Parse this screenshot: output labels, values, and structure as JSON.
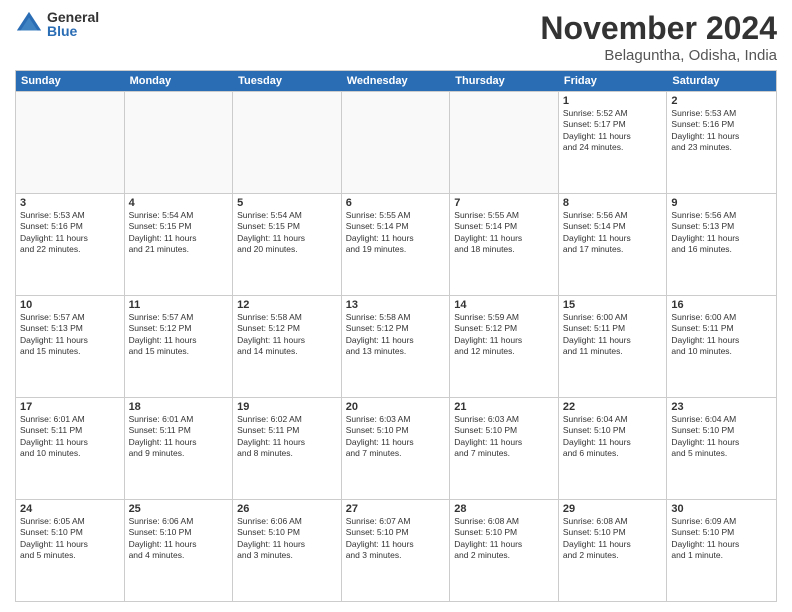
{
  "logo": {
    "general": "General",
    "blue": "Blue"
  },
  "title": "November 2024",
  "location": "Belaguntha, Odisha, India",
  "days_of_week": [
    "Sunday",
    "Monday",
    "Tuesday",
    "Wednesday",
    "Thursday",
    "Friday",
    "Saturday"
  ],
  "weeks": [
    [
      {
        "day": "",
        "info": ""
      },
      {
        "day": "",
        "info": ""
      },
      {
        "day": "",
        "info": ""
      },
      {
        "day": "",
        "info": ""
      },
      {
        "day": "",
        "info": ""
      },
      {
        "day": "1",
        "info": "Sunrise: 5:52 AM\nSunset: 5:17 PM\nDaylight: 11 hours\nand 24 minutes."
      },
      {
        "day": "2",
        "info": "Sunrise: 5:53 AM\nSunset: 5:16 PM\nDaylight: 11 hours\nand 23 minutes."
      }
    ],
    [
      {
        "day": "3",
        "info": "Sunrise: 5:53 AM\nSunset: 5:16 PM\nDaylight: 11 hours\nand 22 minutes."
      },
      {
        "day": "4",
        "info": "Sunrise: 5:54 AM\nSunset: 5:15 PM\nDaylight: 11 hours\nand 21 minutes."
      },
      {
        "day": "5",
        "info": "Sunrise: 5:54 AM\nSunset: 5:15 PM\nDaylight: 11 hours\nand 20 minutes."
      },
      {
        "day": "6",
        "info": "Sunrise: 5:55 AM\nSunset: 5:14 PM\nDaylight: 11 hours\nand 19 minutes."
      },
      {
        "day": "7",
        "info": "Sunrise: 5:55 AM\nSunset: 5:14 PM\nDaylight: 11 hours\nand 18 minutes."
      },
      {
        "day": "8",
        "info": "Sunrise: 5:56 AM\nSunset: 5:14 PM\nDaylight: 11 hours\nand 17 minutes."
      },
      {
        "day": "9",
        "info": "Sunrise: 5:56 AM\nSunset: 5:13 PM\nDaylight: 11 hours\nand 16 minutes."
      }
    ],
    [
      {
        "day": "10",
        "info": "Sunrise: 5:57 AM\nSunset: 5:13 PM\nDaylight: 11 hours\nand 15 minutes."
      },
      {
        "day": "11",
        "info": "Sunrise: 5:57 AM\nSunset: 5:12 PM\nDaylight: 11 hours\nand 15 minutes."
      },
      {
        "day": "12",
        "info": "Sunrise: 5:58 AM\nSunset: 5:12 PM\nDaylight: 11 hours\nand 14 minutes."
      },
      {
        "day": "13",
        "info": "Sunrise: 5:58 AM\nSunset: 5:12 PM\nDaylight: 11 hours\nand 13 minutes."
      },
      {
        "day": "14",
        "info": "Sunrise: 5:59 AM\nSunset: 5:12 PM\nDaylight: 11 hours\nand 12 minutes."
      },
      {
        "day": "15",
        "info": "Sunrise: 6:00 AM\nSunset: 5:11 PM\nDaylight: 11 hours\nand 11 minutes."
      },
      {
        "day": "16",
        "info": "Sunrise: 6:00 AM\nSunset: 5:11 PM\nDaylight: 11 hours\nand 10 minutes."
      }
    ],
    [
      {
        "day": "17",
        "info": "Sunrise: 6:01 AM\nSunset: 5:11 PM\nDaylight: 11 hours\nand 10 minutes."
      },
      {
        "day": "18",
        "info": "Sunrise: 6:01 AM\nSunset: 5:11 PM\nDaylight: 11 hours\nand 9 minutes."
      },
      {
        "day": "19",
        "info": "Sunrise: 6:02 AM\nSunset: 5:11 PM\nDaylight: 11 hours\nand 8 minutes."
      },
      {
        "day": "20",
        "info": "Sunrise: 6:03 AM\nSunset: 5:10 PM\nDaylight: 11 hours\nand 7 minutes."
      },
      {
        "day": "21",
        "info": "Sunrise: 6:03 AM\nSunset: 5:10 PM\nDaylight: 11 hours\nand 7 minutes."
      },
      {
        "day": "22",
        "info": "Sunrise: 6:04 AM\nSunset: 5:10 PM\nDaylight: 11 hours\nand 6 minutes."
      },
      {
        "day": "23",
        "info": "Sunrise: 6:04 AM\nSunset: 5:10 PM\nDaylight: 11 hours\nand 5 minutes."
      }
    ],
    [
      {
        "day": "24",
        "info": "Sunrise: 6:05 AM\nSunset: 5:10 PM\nDaylight: 11 hours\nand 5 minutes."
      },
      {
        "day": "25",
        "info": "Sunrise: 6:06 AM\nSunset: 5:10 PM\nDaylight: 11 hours\nand 4 minutes."
      },
      {
        "day": "26",
        "info": "Sunrise: 6:06 AM\nSunset: 5:10 PM\nDaylight: 11 hours\nand 3 minutes."
      },
      {
        "day": "27",
        "info": "Sunrise: 6:07 AM\nSunset: 5:10 PM\nDaylight: 11 hours\nand 3 minutes."
      },
      {
        "day": "28",
        "info": "Sunrise: 6:08 AM\nSunset: 5:10 PM\nDaylight: 11 hours\nand 2 minutes."
      },
      {
        "day": "29",
        "info": "Sunrise: 6:08 AM\nSunset: 5:10 PM\nDaylight: 11 hours\nand 2 minutes."
      },
      {
        "day": "30",
        "info": "Sunrise: 6:09 AM\nSunset: 5:10 PM\nDaylight: 11 hours\nand 1 minute."
      }
    ]
  ]
}
